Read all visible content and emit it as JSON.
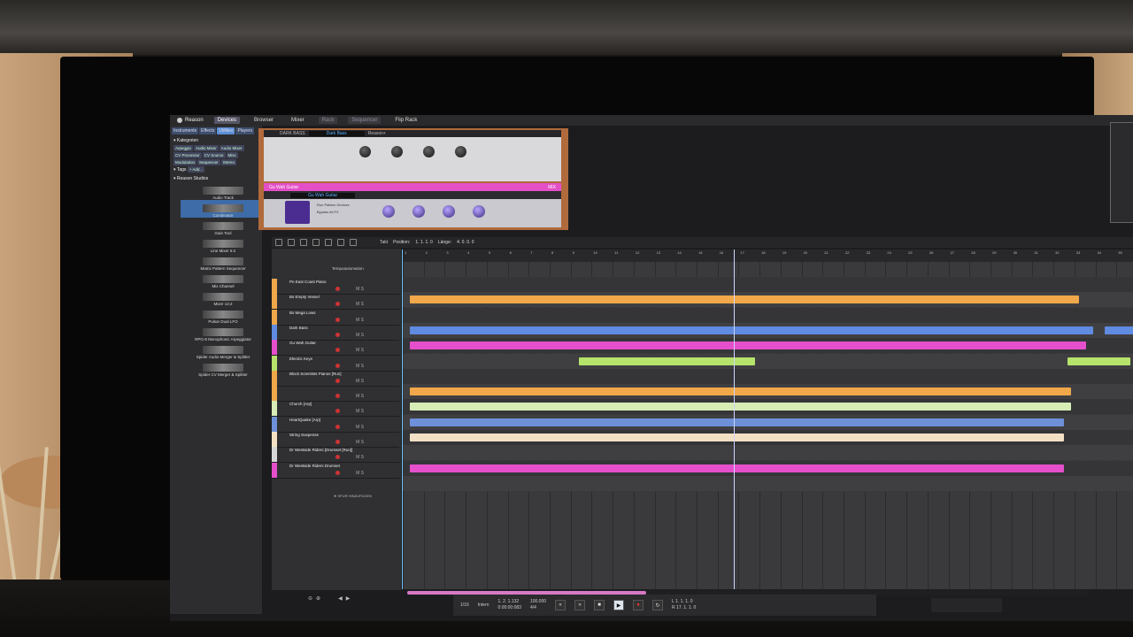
{
  "app": {
    "name": "Reason",
    "nav_tabs": [
      "Devices",
      "Browser",
      "Mixer",
      "Rack",
      "Sequencer",
      "Flip Rack"
    ]
  },
  "browser": {
    "category_tabs": [
      "Instruments",
      "Effects",
      "Utilities",
      "Players"
    ],
    "kategorien_label": "Kategorien",
    "kategorien": [
      "Arpeggio",
      "Audio Mixer",
      "Audio Mixer",
      "CV Processor",
      "CV Source",
      "Misc",
      "Modulation",
      "Sequencer",
      "Stereo"
    ],
    "tags_label": "Tags",
    "add_label": "+ Add...",
    "root": "Reason Studios",
    "devices": [
      "Audio Track",
      "Combinator",
      "Gain Tool",
      "Line Mixer 6:2",
      "Matrix Pattern Sequencer",
      "Mix Channel",
      "Mixer 14:2",
      "Pulsar Dual LFO",
      "RPG-8 Monophonic Arpeggiator",
      "Spider Audio Merger & Splitter",
      "Spider CV Merger & Splitter"
    ],
    "selected_device": "Combinator"
  },
  "rack": {
    "device1_name": "DARK BASS",
    "device1_patch": "Dark Bass",
    "device1_brand": "Reason+",
    "device2_name": "Gu Wah Guitar",
    "device2_patch": "Gu Wah Guitar",
    "device2_mix": "MIX",
    "device2_opt1": "Run Pattern Devices",
    "device2_opt2": "Bypass All FX"
  },
  "sequencer": {
    "toolbar": {
      "snap_label": "Takt",
      "position_label": "Position:",
      "position_value": "1. 1. 1.   0",
      "length_label": "Länge:",
      "length_value": "4. 0. 0.   0"
    },
    "tempo_track_label": "Tempoautomation",
    "add_track_label": "SPUR HINZUFÜGEN",
    "tracks": [
      {
        "name": "Pn East Coast Piano",
        "color": "#f0a84a"
      },
      {
        "name": "Bs Empty Vessel",
        "color": "#f0a84a"
      },
      {
        "name": "Bs Mega Lows",
        "color": "#f0a84a"
      },
      {
        "name": "Dark Bass",
        "color": "#5f8be0"
      },
      {
        "name": "Gu Wah Guitar",
        "color": "#e54fcb"
      },
      {
        "name": "Electric Keys",
        "color": "#b6e36b"
      },
      {
        "name": "Block Scientists Pianos [Run]",
        "color": "#f0a84a"
      },
      {
        "name": "",
        "color": "#f0a84a"
      },
      {
        "name": "Church [Arp]",
        "color": "#d8ecb6"
      },
      {
        "name": "HeartQuake [Arp]",
        "color": "#6d90d8"
      },
      {
        "name": "String Suspense",
        "color": "#f3e0c4"
      },
      {
        "name": "Dr Westside Riders [Drumset [Run]]",
        "color": "#d8d8d8"
      },
      {
        "name": "Dr Westside Riders Drumset",
        "color": "#e54fcb"
      }
    ],
    "colors": {
      "orange": "#f0a84a",
      "blue": "#5f8be0",
      "magenta": "#e54fcb",
      "lime": "#b6e36b",
      "pale": "#d8ecb6",
      "cream": "#f3e0c4",
      "accent": "#6ec6ff"
    },
    "bar_numbers": [
      "1",
      "2",
      "3",
      "4",
      "5",
      "6",
      "7",
      "8",
      "9",
      "10",
      "11",
      "12",
      "13",
      "14",
      "15",
      "16",
      "17",
      "18",
      "19",
      "20",
      "21",
      "22",
      "23",
      "24",
      "25",
      "26",
      "27",
      "28",
      "29",
      "30",
      "31",
      "32",
      "33",
      "34",
      "35"
    ]
  },
  "transport": {
    "quantize_value": "1/16",
    "click_value": "Intern",
    "position": "1. 2. 1.132",
    "time": "0:00:00:083",
    "tempo": "100.000",
    "signature": "4/4",
    "loop_left": "1. 1. 1.   0",
    "loop_right": "17. 1. 1.   0",
    "l_label": "L",
    "r_label": "R"
  }
}
